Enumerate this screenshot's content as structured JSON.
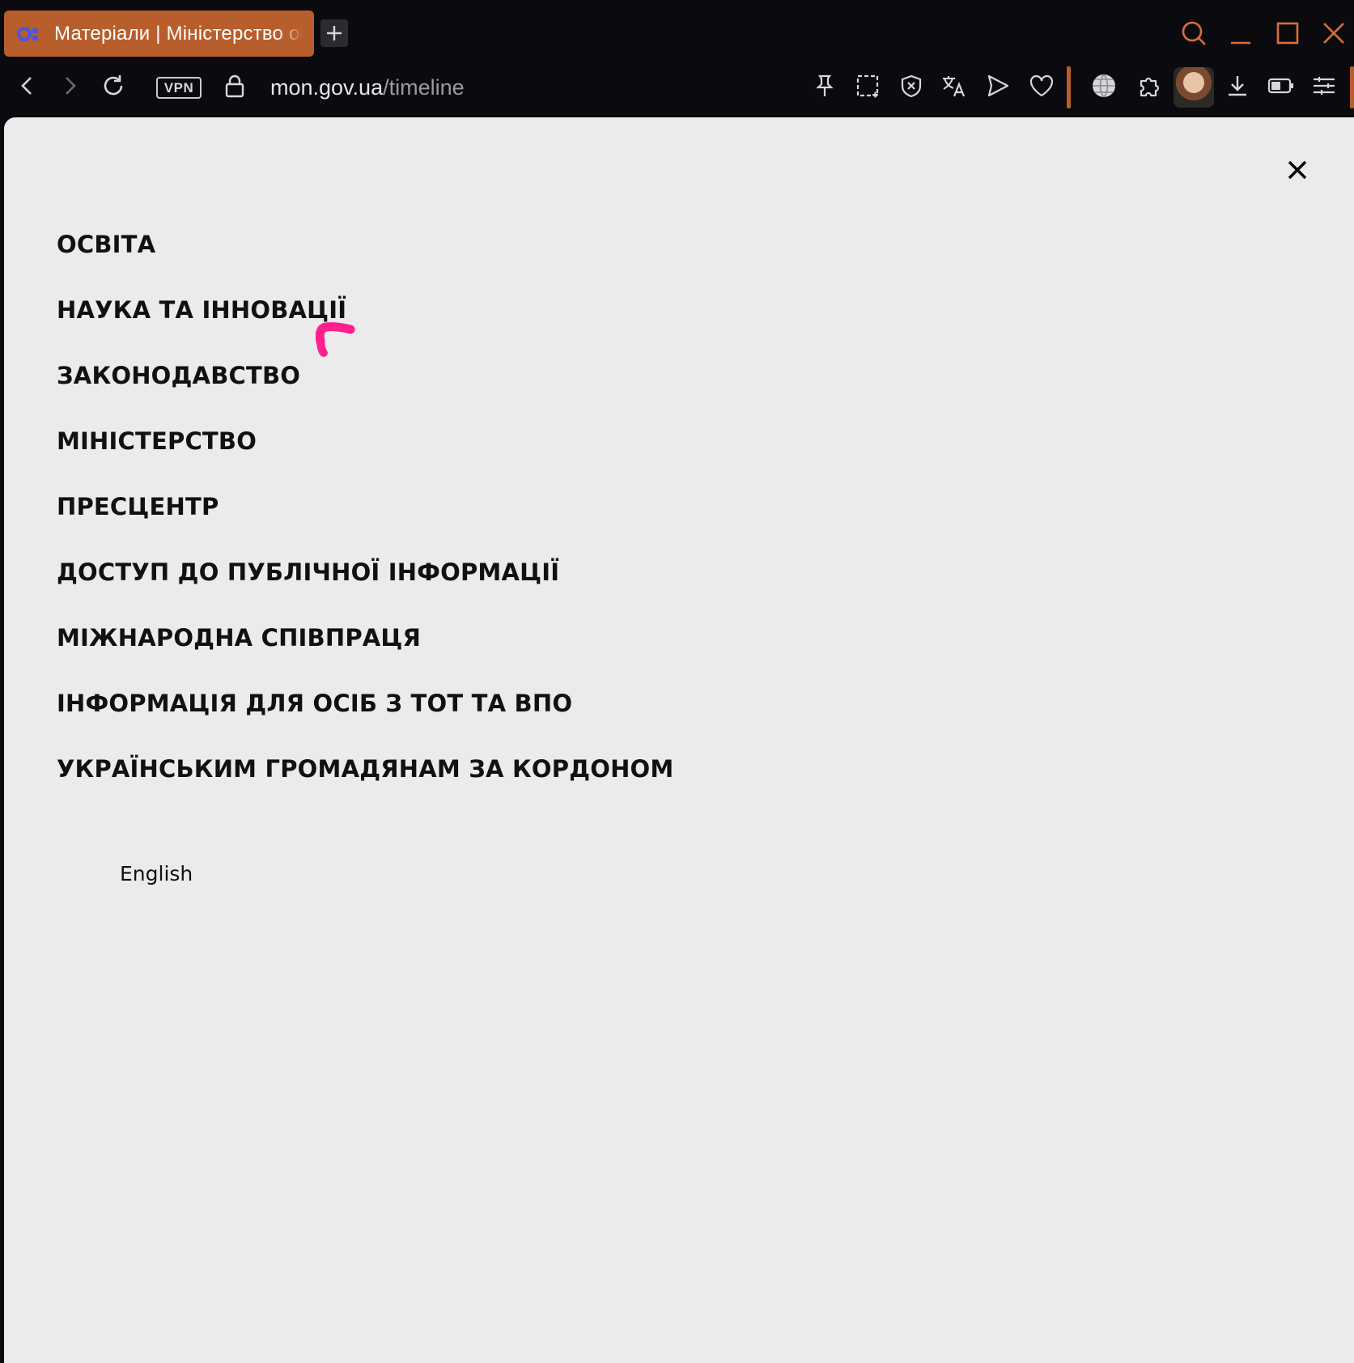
{
  "browser": {
    "tab_title": "Матеріали | Міністерство освіти і науки України",
    "url_host": "mon.gov.ua",
    "url_path": "/timeline",
    "vpn_label": "VPN",
    "accent_color": "#b85e2c"
  },
  "menu": {
    "items": [
      "ОСВІТА",
      "НАУКА ТА ІННОВАЦІЇ",
      "ЗАКОНОДАВСТВО",
      "МІНІСТЕРСТВО",
      "ПРЕСЦЕНТР",
      "ДОСТУП ДО ПУБЛІЧНОЇ ІНФОРМАЦІЇ",
      "МІЖНАРОДНА СПІВПРАЦЯ",
      "ІНФОРМАЦІЯ ДЛЯ ОСІБ З ТОТ ТА ВПО",
      "УКРАЇНСЬКИМ ГРОМАДЯНАМ ЗА КОРДОНОМ"
    ],
    "language_switch": "English",
    "cursor_color": "#ff1f8e"
  }
}
